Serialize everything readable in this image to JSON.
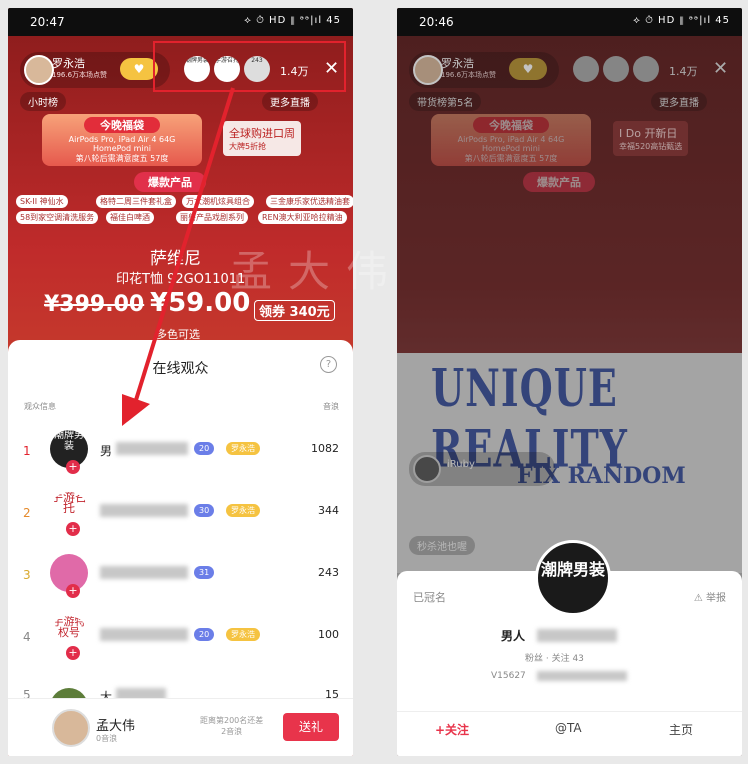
{
  "left": {
    "status": {
      "time": "20:47",
      "icons": "⟡ ⏱ HD ⫴ ᵊᵊ|ıl 45"
    },
    "host": {
      "name": "罗永浩",
      "sub": "196.6万本场点赞"
    },
    "top_viewers": [
      {
        "label": "潮牌男装"
      },
      {
        "label": "手游召托"
      },
      {
        "label": "243"
      }
    ],
    "viewer_count": "1.4万",
    "close": "✕",
    "chip_left": "小时榜",
    "chip_right": "更多直播",
    "banner": {
      "title": "今晚福袋",
      "line1": "AirPods Pro, iPad Air 4 64G",
      "line2": "HomePod mini",
      "line3": "第八轮后需满意度五 57度"
    },
    "banner2": {
      "title": "全球购进口周",
      "sub": "大牌5折抢"
    },
    "section": "爆款产品",
    "tags": [
      "SK-II 神仙水",
      "格特二周三件套礼盒",
      "万太潮机炫具组合",
      "三金康乐家优选精油套",
      "58到家空调清洗服务",
      "福佳白啤酒",
      "丽兽产品戏剧系列",
      "REN澳大利亚哈拉精油"
    ],
    "product": {
      "brand": "萨维尼",
      "name": "印花T恤 92GO11011",
      "old_price": "¥399.00",
      "new_price": "¥59.00",
      "coupon": "领券 340元",
      "multi": "多色可选"
    },
    "watermark": "孟大伟",
    "sheet": {
      "title": "在线观众",
      "help": "?",
      "col_left": "观众信息",
      "col_right": "音浪",
      "rows": [
        {
          "rank": "1",
          "avatar": "潮牌男装",
          "name": "男",
          "level": "20",
          "fan": "罗永浩",
          "score": "1082"
        },
        {
          "rank": "2",
          "avatar": "手游召托",
          "name": "",
          "level": "30",
          "fan": "罗永浩",
          "score": "344"
        },
        {
          "rank": "3",
          "avatar": "",
          "name": "",
          "level": "31",
          "fan": "",
          "score": "243"
        },
        {
          "rank": "4",
          "avatar": "手游特权号",
          "name": "",
          "level": "20",
          "fan": "罗永浩",
          "score": "100"
        },
        {
          "rank": "5",
          "avatar": "",
          "name": "大",
          "level": "",
          "fan": "",
          "score": "15"
        }
      ],
      "self": {
        "name": "孟大伟",
        "sub": "0音浪",
        "gap": "距离第200名还差\n2音浪",
        "send": "送礼"
      }
    }
  },
  "right": {
    "status": {
      "time": "20:46",
      "icons": "⟡ ⏱ HD ⫴ ᵊᵊ|ıl 45"
    },
    "host": {
      "name": "罗永浩",
      "sub": "196.6万本场点赞"
    },
    "viewer_count": "1.4万",
    "close": "✕",
    "chip_left": "带货榜第5名",
    "chip_right": "更多直播",
    "banner": {
      "title": "今晚福袋",
      "line1": "AirPods Pro, iPad Air 4 64G",
      "line2": "HomePod mini",
      "line3": "第八轮后需满意度五 57度"
    },
    "banner2": {
      "title": "I Do 开新日",
      "sub": "幸福520高钻甄选"
    },
    "section": "爆款产品",
    "shirt": {
      "line1": "UNIQUE REALITY",
      "line2": "FIX RANDOM"
    },
    "comment_user": "iRuby",
    "comment_text": "秒杀池也喔",
    "card": {
      "badge": "已冠名",
      "report": "⚠ 举报",
      "avatar": "潮牌男装",
      "name": "男人",
      "stats": "粉丝 · 关注 43",
      "id": "V15627",
      "follow": "+关注",
      "at": "@TA",
      "home": "主页"
    }
  },
  "colors": {
    "accent": "#e8344b",
    "highlight": "#e2222d",
    "level": "#6b7ee8",
    "fan": "#f5c341"
  }
}
